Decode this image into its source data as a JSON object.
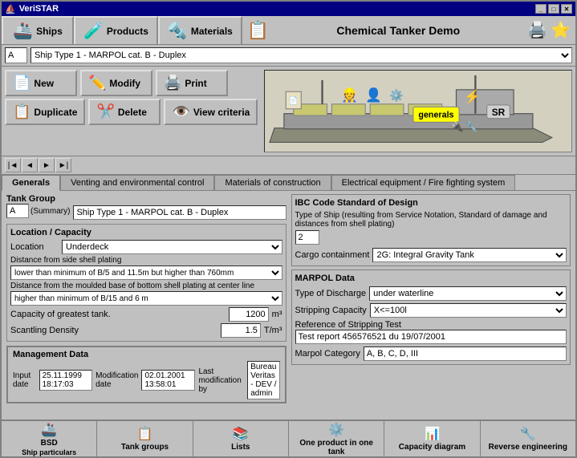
{
  "window": {
    "title": "VeriSTAR"
  },
  "app_title": "Chemical Tanker Demo",
  "nav_tabs": [
    {
      "id": "ships",
      "label": "Ships",
      "icon": "🚢"
    },
    {
      "id": "products",
      "label": "Products",
      "icon": "📦"
    },
    {
      "id": "materials",
      "label": "Materials",
      "icon": "🔩"
    }
  ],
  "dropdown": {
    "tank_group_code": "A",
    "ship_name": "Ship Type 1 - MARPOL cat. B - Duplex"
  },
  "buttons": {
    "new": "New",
    "modify": "Modify",
    "print": "Print",
    "duplicate": "Duplicate",
    "delete": "Delete",
    "view_criteria": "View criteria"
  },
  "tabs": {
    "generals": "Generals",
    "venting": "Venting and environmental control",
    "materials": "Materials of construction",
    "electrical": "Electrical equipment / Fire fighting system"
  },
  "left_panel": {
    "tank_group_label": "Tank Group",
    "tank_group_code": "A",
    "tank_group_summary": "(Summary)",
    "tank_group_name": "Ship Type 1 - MARPOL cat. B - Duplex",
    "location_capacity_header": "Location / Capacity",
    "location_label": "Location",
    "location_value": "Underdeck",
    "distance_side_label": "Distance from side shell plating",
    "distance_side_value": "lower than minimum of B/5 and 11.5m but higher than 760mm",
    "distance_bottom_label": "Distance from the moulded base of bottom shell plating at center line",
    "distance_bottom_value": "higher than minimum of B/15 and 6 m",
    "capacity_label": "Capacity of greatest tank.",
    "capacity_value": "1200",
    "capacity_unit": "m³",
    "scantling_label": "Scantling Density",
    "scantling_value": "1.5",
    "scantling_unit": "T/m³"
  },
  "right_panel": {
    "ibc_header": "IBC Code Standard of Design",
    "type_ship_label": "Type of Ship (resulting from Service Notation, Standard of damage and distances from shell plating)",
    "type_ship_value": "2",
    "cargo_label": "Cargo containment",
    "cargo_value": "2G: Integral Gravity Tank",
    "marpol_header": "MARPOL Data",
    "discharge_label": "Type of Discharge",
    "discharge_value": "under waterline",
    "stripping_label": "Stripping Capacity",
    "stripping_value": "X<=100l",
    "reference_label": "Reference of Stripping Test",
    "reference_value": "Test report 456576521 du 19/07/2001",
    "marpol_cat_label": "Marpol Category",
    "marpol_cat_value": "A, B, C, D, III"
  },
  "management_data": {
    "header": "Management Data",
    "input_date_label": "Input date",
    "input_date_value": "25.11.1999 18:17:03",
    "modification_date_label": "Modification date",
    "modification_date_value": "02.01.2001 13:58:01",
    "last_mod_label": "Last modification by",
    "last_mod_value": "Bureau Veritas - DEV / admin"
  },
  "bottom_tabs": [
    {
      "id": "bsd",
      "label": "BSD",
      "sublabel": "Ship particulars",
      "icon": "🚢"
    },
    {
      "id": "tank_groups",
      "label": "Tank groups",
      "icon": "📋"
    },
    {
      "id": "lists",
      "label": "Lists",
      "icon": "📚"
    },
    {
      "id": "one_product",
      "label": "One product in one tank",
      "icon": "⚙️"
    },
    {
      "id": "capacity",
      "label": "Capacity diagram",
      "icon": "📊"
    },
    {
      "id": "reverse",
      "label": "Reverse engineering",
      "icon": "🔧"
    }
  ]
}
